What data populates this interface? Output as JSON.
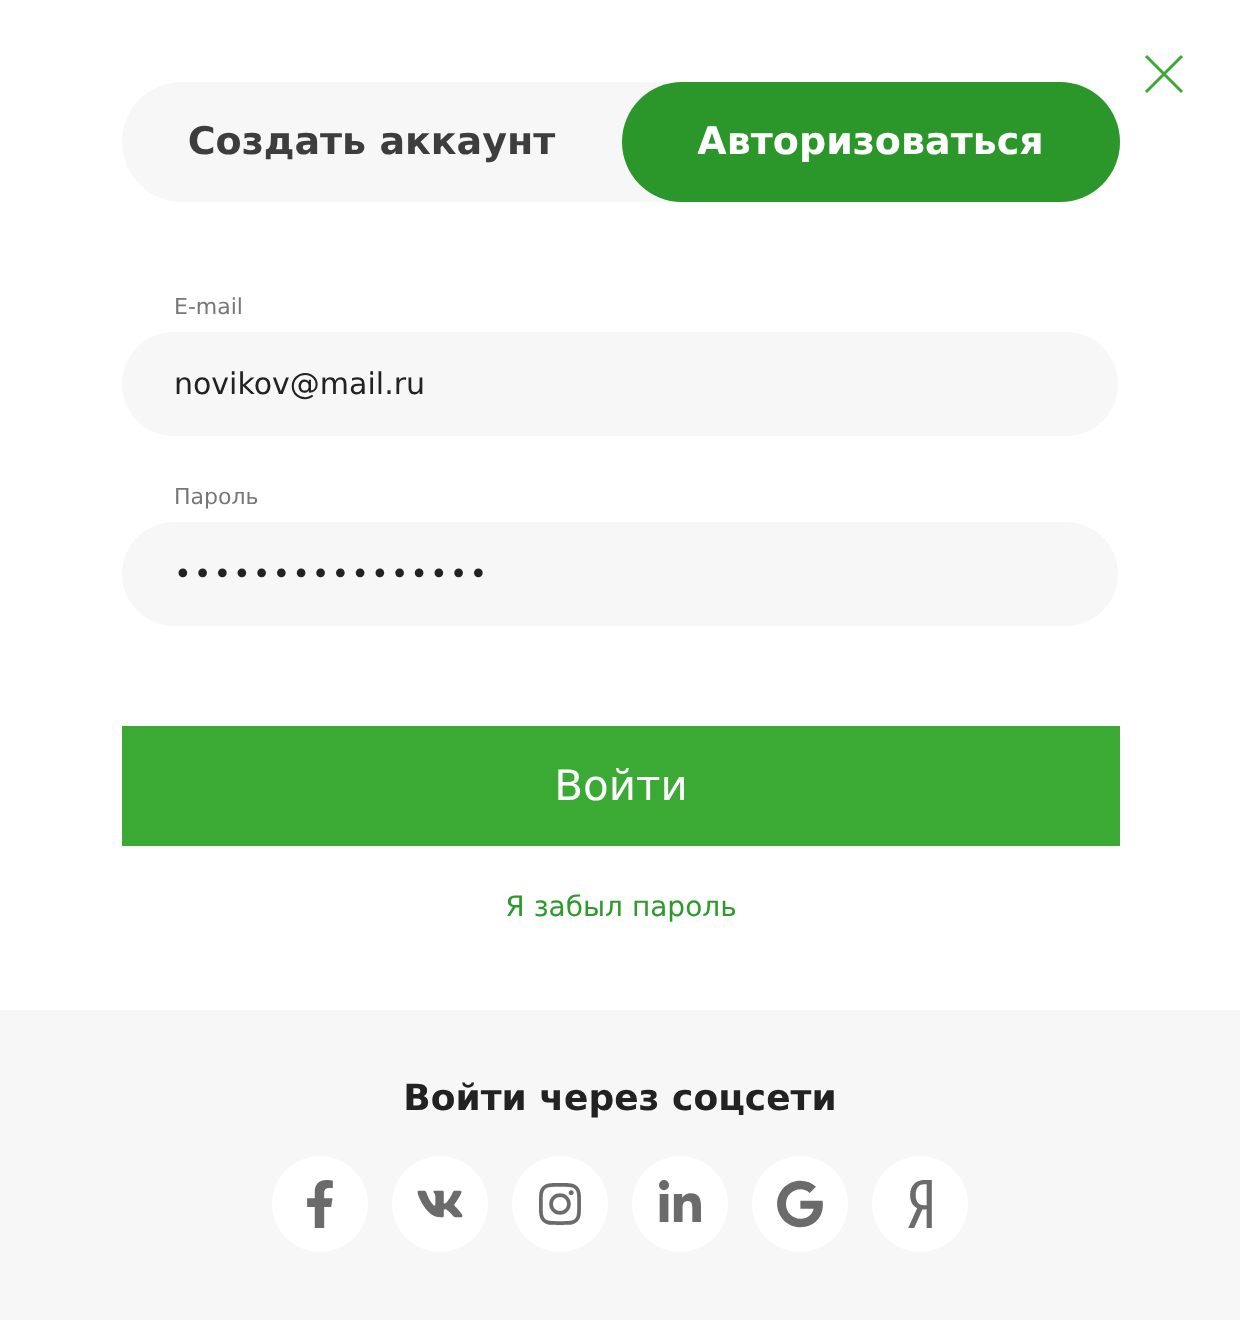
{
  "tabs": [
    {
      "label": "Создать аккаунт",
      "selected": false
    },
    {
      "label": "Авторизоваться",
      "selected": true
    }
  ],
  "fields": [
    {
      "label": "E-mail",
      "value": "novikov@mail.ru"
    },
    {
      "label": "Пароль",
      "value": "••••••••••••••••"
    }
  ],
  "submit": "Войти",
  "forgot_link": "Я забыл пароль",
  "social": {
    "title": "Войти через соцсети",
    "items": [
      {
        "kind": "facebook"
      },
      {
        "kind": "vk"
      },
      {
        "kind": "instagram"
      },
      {
        "kind": "linkedin"
      },
      {
        "kind": "google"
      },
      {
        "kind": "yandex"
      }
    ]
  }
}
